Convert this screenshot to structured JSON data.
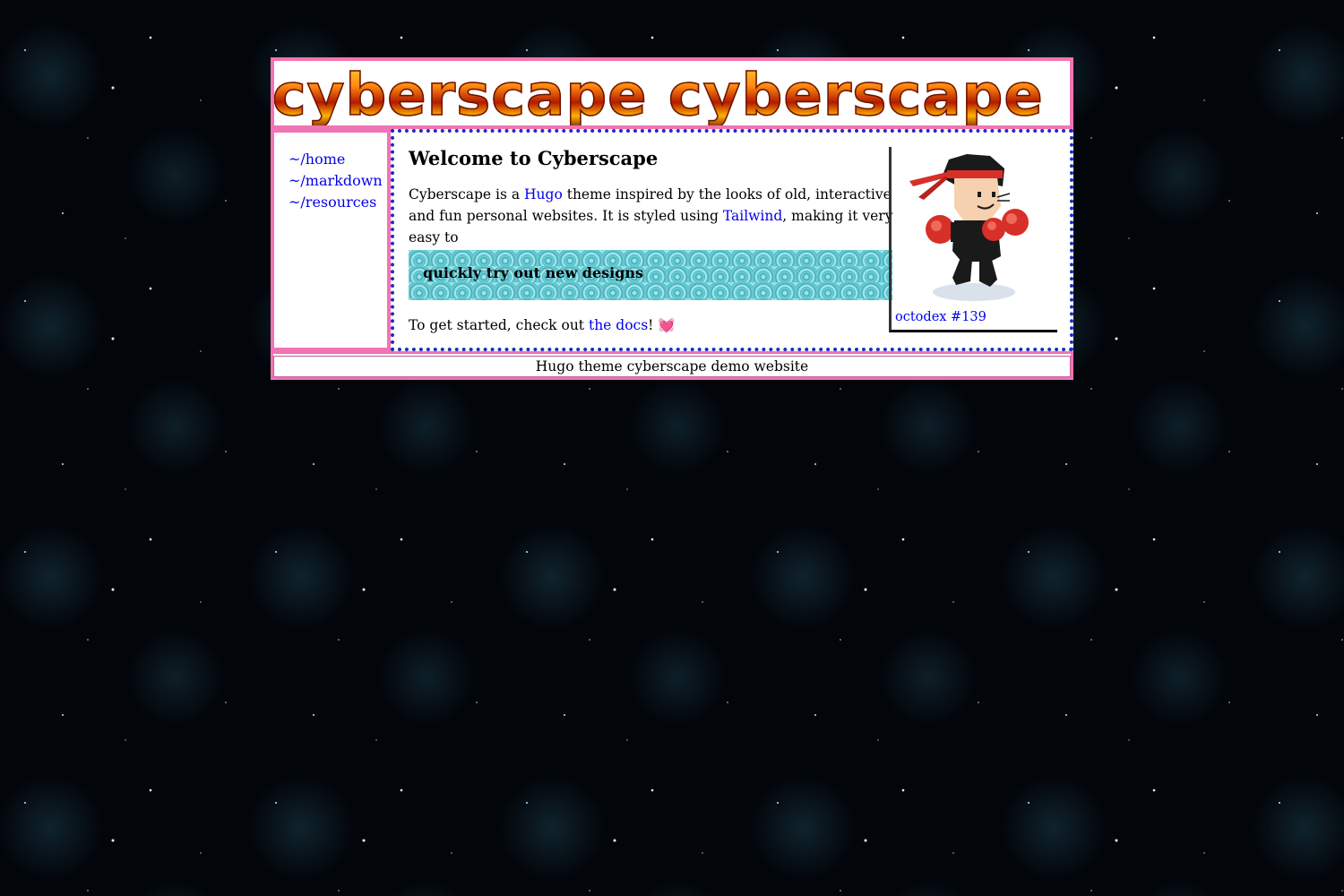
{
  "banner": {
    "text": "e cyberscape cyberscape"
  },
  "nav": {
    "items": [
      {
        "label": "~/home"
      },
      {
        "label": "~/markdown"
      },
      {
        "label": "~/resources"
      }
    ]
  },
  "main": {
    "title": "Welcome to Cyberscape",
    "intro": {
      "t1": "Cyberscape is a ",
      "hugo_link": "Hugo",
      "t2": " theme inspired by the looks of old, interactive and fun personal websites. It is styled using ",
      "tailwind_link": "Tailwind",
      "t3": ", making it very easy to"
    },
    "highlight": "quickly try out new designs",
    "outro": {
      "t1": "To get started, check out ",
      "docs_link": "the docs",
      "t2": "! ",
      "heart": "💓"
    }
  },
  "figure": {
    "caption": "octodex #139"
  },
  "footer": {
    "text": "Hugo theme cyberscape demo website"
  },
  "colors": {
    "frame_border": "#f174b4",
    "dotted_border": "#1a2ec4",
    "link": "#0000ee",
    "wave": "#48b9c4"
  }
}
